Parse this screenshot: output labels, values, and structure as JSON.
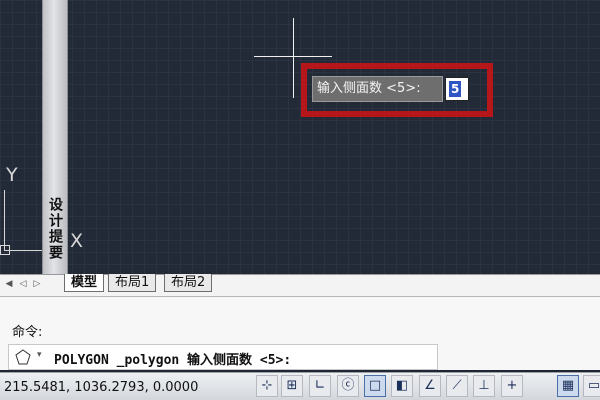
{
  "prompt": {
    "label": "输入侧面数 <5>:",
    "value": "5"
  },
  "ucs": {
    "y_label": "Y",
    "x_label": "X"
  },
  "palette": {
    "title": "设计提要"
  },
  "tabs": [
    {
      "label": "模型",
      "active": true
    },
    {
      "label": "布局1",
      "active": false
    },
    {
      "label": "布局2",
      "active": false
    }
  ],
  "command": {
    "history": "命令:",
    "current": "POLYGON _polygon 输入侧面数 <5>:"
  },
  "status": {
    "coordinates": "215.5481, 1036.2793, 0.0000",
    "buttons": [
      {
        "icon": "snap-icon",
        "glyph": "⊹",
        "on": false
      },
      {
        "icon": "grid-icon",
        "glyph": "⊞",
        "on": false
      },
      {
        "icon": "ortho-icon",
        "glyph": "∟",
        "on": false
      },
      {
        "icon": "polar-icon",
        "glyph": "ⓒ",
        "on": false
      },
      {
        "icon": "osnap-icon",
        "glyph": "□",
        "on": true
      },
      {
        "icon": "3d-osnap-icon",
        "glyph": "◧",
        "on": false
      },
      {
        "icon": "otrack-icon",
        "glyph": "∠",
        "on": false
      },
      {
        "icon": "ducs-icon",
        "glyph": "⟋",
        "on": false
      },
      {
        "icon": "dyn-icon",
        "glyph": "⊥",
        "on": false
      },
      {
        "icon": "lineweight-icon",
        "glyph": "+",
        "on": false
      },
      {
        "icon": "transparency-icon",
        "glyph": "▦",
        "on": true
      },
      {
        "icon": "quick-properties-icon",
        "glyph": "▭",
        "on": false
      }
    ]
  }
}
